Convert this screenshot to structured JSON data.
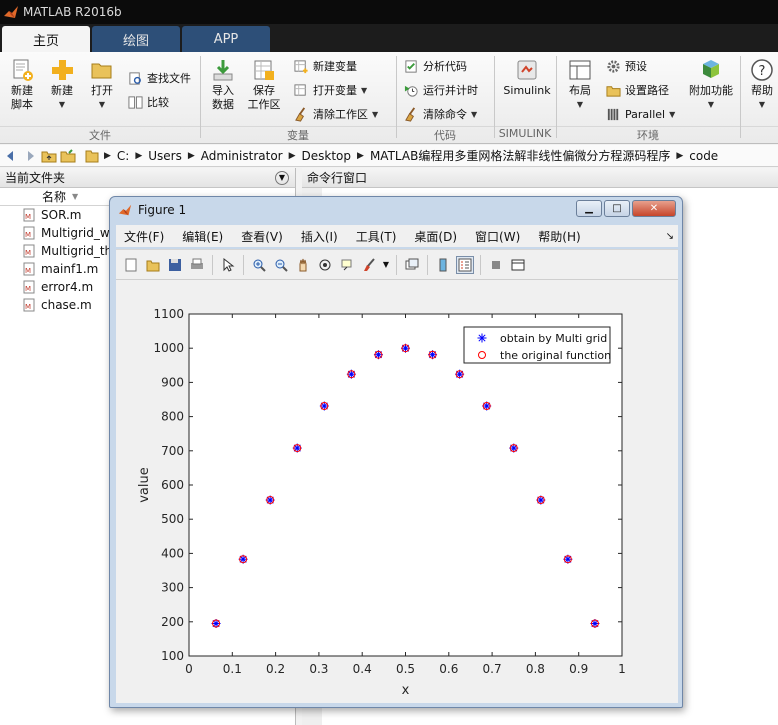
{
  "app": {
    "title": "MATLAB R2016b",
    "tabs": [
      {
        "label": "主页",
        "active": true
      },
      {
        "label": "绘图",
        "active": false
      },
      {
        "label": "APP",
        "active": false
      }
    ]
  },
  "ribbon": {
    "new_script": "新建\n脚本",
    "new": "新建",
    "open": "打开",
    "find_files": "查找文件",
    "compare": "比较",
    "import_data": "导入\n数据",
    "save_workspace": "保存\n工作区",
    "new_variable": "新建变量",
    "open_variable": "打开变量",
    "clear_workspace": "清除工作区",
    "analyze_code": "分析代码",
    "run_and_time": "运行并计时",
    "clear_commands": "清除命令",
    "simulink": "Simulink",
    "layout": "布局",
    "preferences": "预设",
    "set_path": "设置路径",
    "parallel": "Parallel",
    "addons": "附加功能",
    "help": "帮助",
    "groups": {
      "file": "文件",
      "variable": "变量",
      "code": "代码",
      "simulink": "SIMULINK",
      "environment": "环境"
    }
  },
  "address": {
    "crumbs": [
      "C:",
      "Users",
      "Administrator",
      "Desktop",
      "MATLAB编程用多重网格法解非线性偏微分方程源码程序",
      "code"
    ]
  },
  "current_folder": {
    "title": "当前文件夹",
    "name_column": "名称",
    "files": [
      "SOR.m",
      "Multigrid_w",
      "Multigrid_th",
      "mainf1.m",
      "error4.m",
      "chase.m"
    ]
  },
  "command_window": {
    "title": "命令行窗口"
  },
  "figure": {
    "title": "Figure 1",
    "menu": [
      "文件(F)",
      "编辑(E)",
      "查看(V)",
      "插入(I)",
      "工具(T)",
      "桌面(D)",
      "窗口(W)",
      "帮助(H)"
    ]
  },
  "chart_data": {
    "type": "scatter",
    "title": "",
    "xlabel": "x",
    "ylabel": "value",
    "xlim": [
      0,
      1
    ],
    "ylim": [
      100,
      1100
    ],
    "xticks": [
      "0",
      "0.1",
      "0.2",
      "0.3",
      "0.4",
      "0.5",
      "0.6",
      "0.7",
      "0.8",
      "0.9",
      "1"
    ],
    "yticks": [
      "100",
      "200",
      "300",
      "400",
      "500",
      "600",
      "700",
      "800",
      "900",
      "1000",
      "1100"
    ],
    "grid": false,
    "legend_position": "top-right",
    "x": [
      0.0625,
      0.125,
      0.1875,
      0.25,
      0.3125,
      0.375,
      0.4375,
      0.5,
      0.5625,
      0.625,
      0.6875,
      0.75,
      0.8125,
      0.875,
      0.9375
    ],
    "series": [
      {
        "name": "obtain by Multi grid",
        "marker": "star",
        "color": "#0000ff",
        "values": [
          195,
          383,
          556,
          708,
          831,
          924,
          981,
          1000,
          981,
          924,
          831,
          708,
          556,
          383,
          195
        ]
      },
      {
        "name": "the original function",
        "marker": "circle",
        "color": "#ff0000",
        "values": [
          195,
          383,
          556,
          708,
          831,
          924,
          981,
          1000,
          981,
          924,
          831,
          708,
          556,
          383,
          195
        ]
      }
    ]
  }
}
